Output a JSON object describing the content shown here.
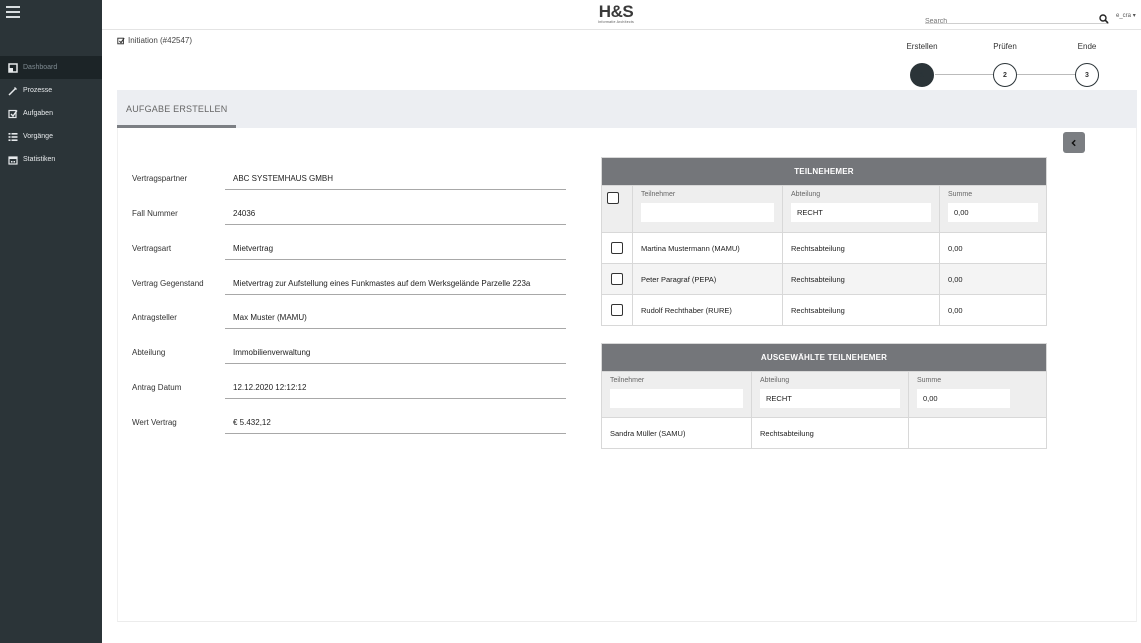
{
  "topbar": {
    "logo": "H&S",
    "logo_sub": "Informatie Architects",
    "search_placeholder": "Search",
    "user": "e_cra"
  },
  "sidebar": {
    "items": [
      {
        "label": "Dashboard",
        "icon": "dashboard-icon"
      },
      {
        "label": "Prozesse",
        "icon": "wand-icon"
      },
      {
        "label": "Aufgaben",
        "icon": "checkbox-icon"
      },
      {
        "label": "Vorgänge",
        "icon": "list-icon"
      },
      {
        "label": "Statistiken",
        "icon": "calendar-icon"
      }
    ]
  },
  "breadcrumb": "Initiation (#42547)",
  "stepper": {
    "steps": [
      {
        "label": "Erstellen",
        "number": "1"
      },
      {
        "label": "Prüfen",
        "number": "2"
      },
      {
        "label": "Ende",
        "number": "3"
      }
    ],
    "active_step": 1
  },
  "tab": {
    "label": "AUFGABE ERSTELLEN"
  },
  "form": {
    "fields": [
      {
        "label": "Vertragspartner",
        "value": "ABC SYSTEMHAUS GMBH"
      },
      {
        "label": "Fall Nummer",
        "value": "24036"
      },
      {
        "label": "Vertragsart",
        "value": "Mietvertrag"
      },
      {
        "label": "Vertrag Gegenstand",
        "value": "Mietvertrag zur Aufstellung eines Funkmastes auf dem Werksgelände Parzelle 223a"
      },
      {
        "label": "Antragsteller",
        "value": "Max Muster (MAMU)"
      },
      {
        "label": "Abteilung",
        "value": "Immobilienverwaltung"
      },
      {
        "label": "Antrag Datum",
        "value": "12.12.2020 12:12:12"
      },
      {
        "label": "Wert Vertrag",
        "value": "€ 5.432,12"
      }
    ]
  },
  "participants": {
    "title": "TEILNEHEMER",
    "columns": [
      "Teilnehmer",
      "Abteilung",
      "Summe"
    ],
    "filters": [
      "",
      "RECHT",
      "0,00"
    ],
    "rows": [
      {
        "name": "Martina Mustermann (MAMU)",
        "dept": "Rechtsabteilung",
        "sum": "0,00"
      },
      {
        "name": "Peter Paragraf (PEPA)",
        "dept": "Rechtsabteilung",
        "sum": "0,00"
      },
      {
        "name": "Rudolf Rechthaber (RURE)",
        "dept": "Rechtsabteilung",
        "sum": "0,00"
      }
    ]
  },
  "selected": {
    "title": "AUSGEWÄHLTE TEILNEHEMER",
    "columns": [
      "Teilnehmer",
      "Abteilung",
      "Summe"
    ],
    "filters": [
      "",
      "RECHT",
      "0,00"
    ],
    "rows": [
      {
        "name": "Sandra Müller (SAMU)",
        "dept": "Rechtsabteilung",
        "sum": ""
      }
    ]
  },
  "colors": {
    "sidebar": "#2b3438",
    "table_header": "#74767a",
    "band": "#eceef2"
  }
}
